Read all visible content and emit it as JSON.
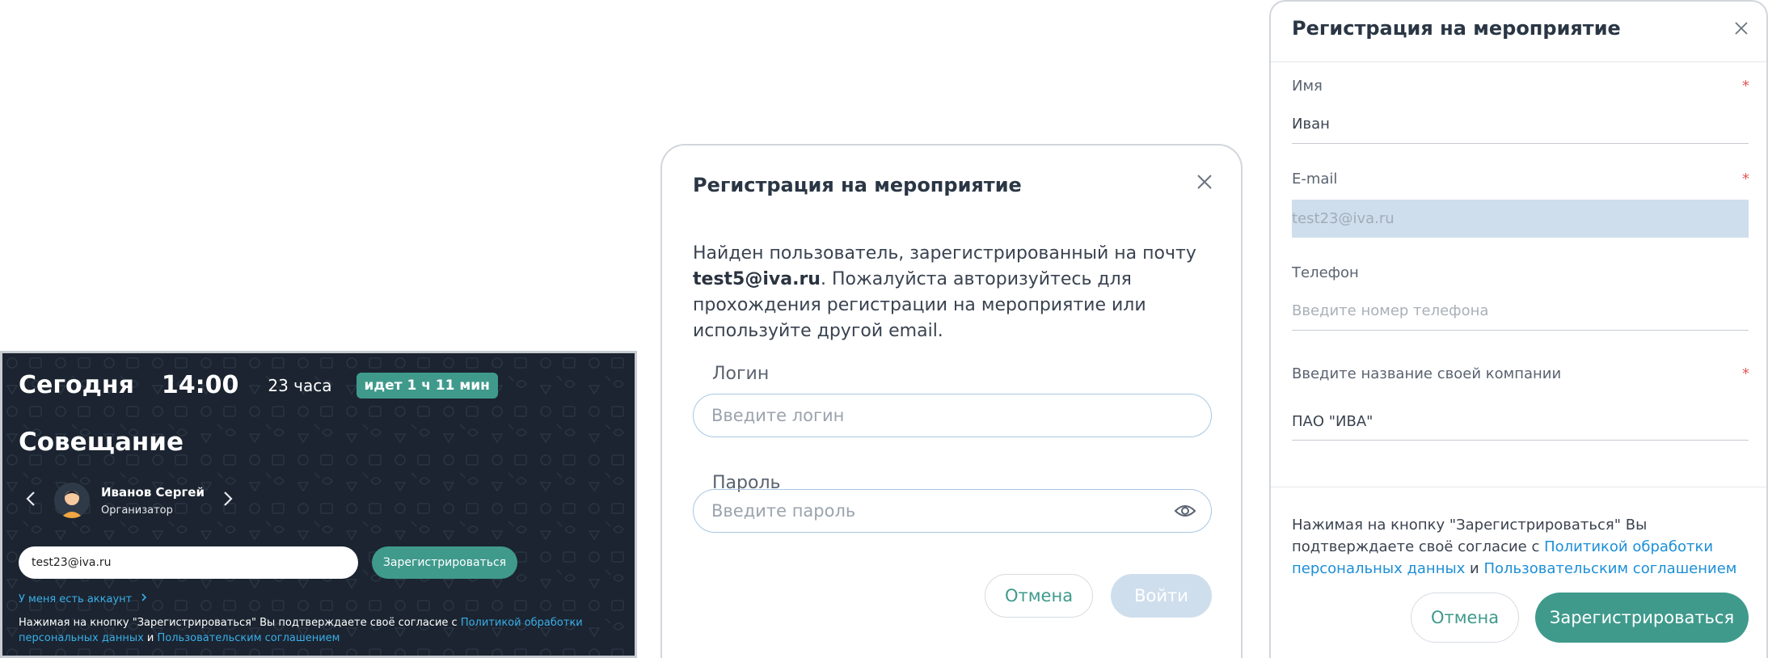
{
  "event_card": {
    "today": "Сегодня",
    "time": "14:00",
    "remaining": "23 часа",
    "ongoing_badge": "идет 1 ч 11 мин",
    "title": "Совещание",
    "organizer_name": "Иванов Сергей",
    "organizer_role": "Организатор",
    "email_value": "test23@iva.ru",
    "register_label": "Зарегистрироваться",
    "have_account": "У меня есть аккаунт",
    "consent_prefix": "Нажимая на кнопку \"Зарегистрироваться\" Вы подтверждаете своё согласие с ",
    "consent_link1": "Политикой обработки персональных данных",
    "consent_and": " и ",
    "consent_link2": "Пользовательским соглашением",
    "colors": {
      "background": "#1b2430",
      "accent": "#3f9a8c",
      "link": "#3aaee8"
    }
  },
  "login_modal": {
    "title": "Регистрация на мероприятие",
    "message_part1": "Найден пользователь, зарегистрированный на почту ",
    "message_email": "test5@iva.ru",
    "message_part2": ". Пожалуйста авторизуйтесь для прохождения регистрации на мероприятие или используйте другой email.",
    "login_label": "Логин",
    "login_placeholder": "Введите логин",
    "password_label": "Пароль",
    "password_placeholder": "Введите пароль",
    "cancel_label": "Отмена",
    "submit_label": "Войти",
    "icons": {
      "close": "close-icon",
      "password_visibility": "eye-icon"
    }
  },
  "registration_form": {
    "title": "Регистрация на мероприятие",
    "name_label": "Имя",
    "name_value": "Иван",
    "email_label": "E-mail",
    "email_value": "test23@iva.ru",
    "phone_label": "Телефон",
    "phone_placeholder": "Введите номер телефона",
    "company_label": "Введите название своей компании",
    "company_value": "ПАО \"ИВА\"",
    "required_mark": "*",
    "consent_prefix": "Нажимая на кнопку \"Зарегистрироваться\" Вы подтверждаете своё согласие с ",
    "consent_link1": "Политикой обработки персональных данных",
    "consent_and": " и ",
    "consent_link2": "Пользовательским соглашением",
    "cancel_label": "Отмена",
    "register_label": "Зарегистрироваться",
    "colors": {
      "accent": "#3f9a8c",
      "required": "#e25555",
      "link": "#1d8fd6"
    }
  }
}
